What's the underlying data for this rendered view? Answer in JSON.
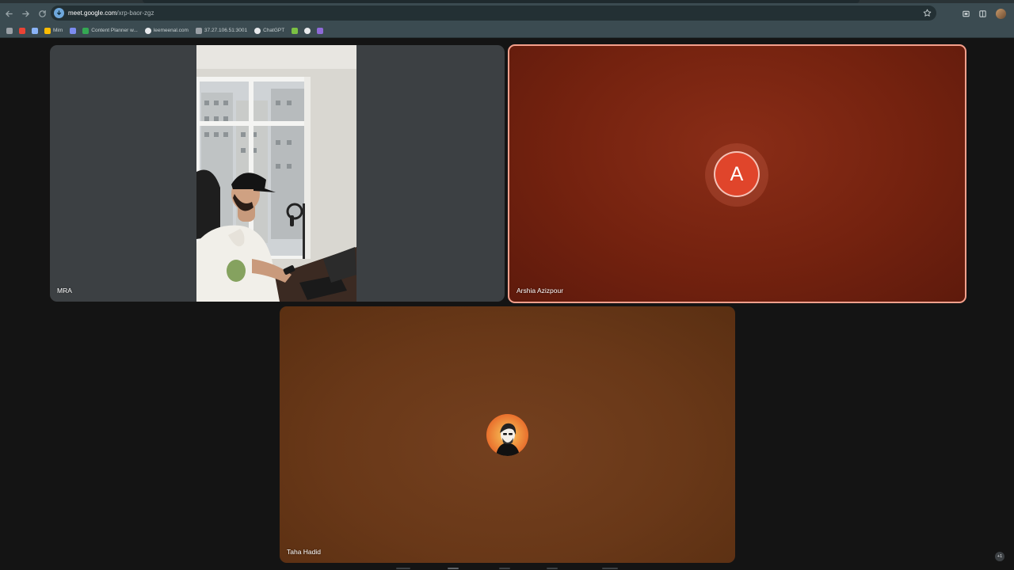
{
  "browser": {
    "url_host": "meet.google.com",
    "url_path": "/xrp-baor-zgz",
    "icons": {
      "back": "arrow-left-icon",
      "forward": "arrow-right-icon",
      "reload": "reload-icon",
      "site_info": "download-badge-icon",
      "bookmark": "star-icon",
      "extensions": "puzzle-icon",
      "cast": "cast-icon",
      "profile": "avatar"
    }
  },
  "bookmarks": [
    {
      "label": "",
      "icon": "apps-grid-icon",
      "color": "#9aa0a6"
    },
    {
      "label": "",
      "icon": "gmail-icon",
      "color": "#ea4335"
    },
    {
      "label": "",
      "icon": "folder-icon",
      "color": "#8ab4f8"
    },
    {
      "label": "Mim",
      "icon": "bookmark-icon",
      "color": "#fbbc04"
    },
    {
      "label": "",
      "icon": "layers-icon",
      "color": "#7c8cf0"
    },
    {
      "label": "Content Planner w...",
      "icon": "planner-icon",
      "color": "#34a853"
    },
    {
      "label": "leemeenal.com",
      "icon": "globe-icon",
      "color": "#e8eaed"
    },
    {
      "label": "37.27.106.51:3001",
      "icon": "server-icon",
      "color": "#9aa0a6"
    },
    {
      "label": "ChatGPT",
      "icon": "chatgpt-icon",
      "color": "#e8eaed"
    },
    {
      "label": "",
      "icon": "green-app-icon",
      "color": "#7bc043"
    },
    {
      "label": "",
      "icon": "github-icon",
      "color": "#e8eaed"
    },
    {
      "label": "",
      "icon": "purple-app-icon",
      "color": "#8e6ad8"
    }
  ],
  "participants": [
    {
      "name": "MRA",
      "type": "video"
    },
    {
      "name": "Arshia Azizpour",
      "type": "initial-avatar",
      "initial": "A",
      "speaking": true,
      "accent": "#e0452b"
    },
    {
      "name": "Taha Hadid",
      "type": "photo-avatar"
    }
  ],
  "overflow_badge": "+1"
}
